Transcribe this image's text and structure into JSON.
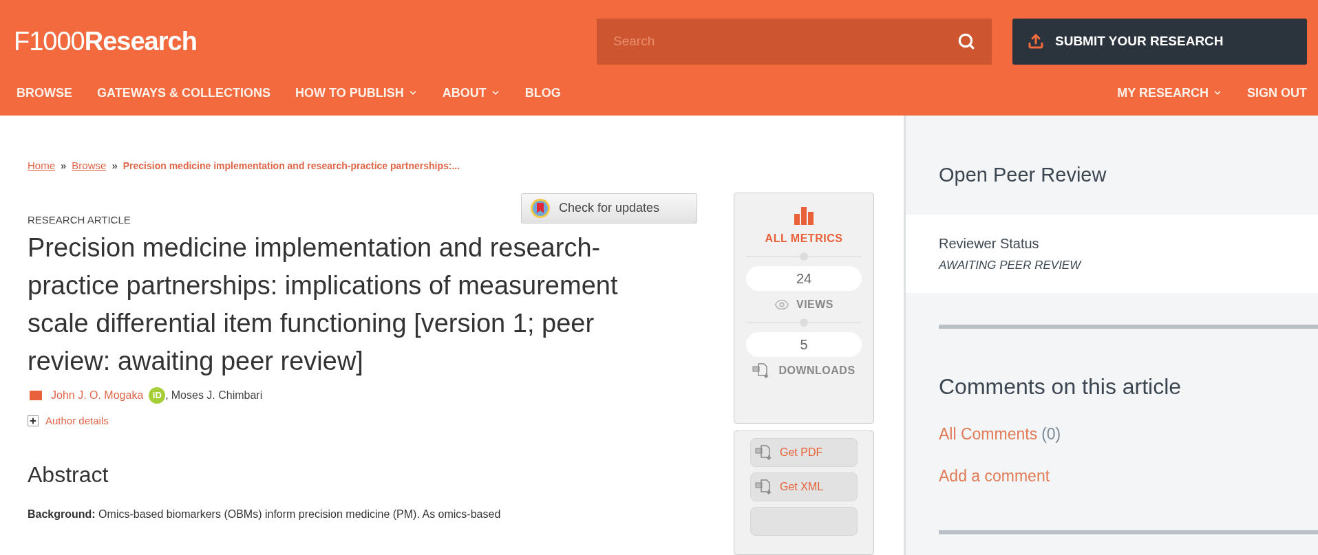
{
  "header": {
    "logo": "F1000**Research**",
    "search": {
      "placeholder": "Search"
    },
    "submit_button": "SUBMIT YOUR RESEARCH"
  },
  "nav": {
    "left": [
      {
        "label": "BROWSE",
        "dropdown": false
      },
      {
        "label": "GATEWAYS & COLLECTIONS",
        "dropdown": false
      },
      {
        "label": "HOW TO PUBLISH",
        "dropdown": true
      },
      {
        "label": "ABOUT",
        "dropdown": true
      },
      {
        "label": "BLOG",
        "dropdown": false
      }
    ],
    "right": [
      {
        "label": "MY RESEARCH",
        "dropdown": true
      },
      {
        "label": "SIGN OUT",
        "dropdown": false
      }
    ]
  },
  "breadcrumb": [
    {
      "label": "Home",
      "kind": "link"
    },
    {
      "label": "»",
      "kind": "separator"
    },
    {
      "label": "Browse",
      "kind": "link"
    },
    {
      "label": "»",
      "kind": "separator"
    },
    {
      "label": "Precision medicine implementation and research-practice partnerships:...",
      "kind": "current"
    }
  ],
  "check_updates_button": "Check for updates",
  "article": {
    "type_label": "RESEARCH ARTICLE",
    "title": "Precision medicine implementation and research-practice partnerships: implications of measurement scale differential item functioning [version 1; peer review: awaiting peer review]",
    "authors": [
      {
        "name": "John J. O. Mogaka",
        "corresponding": true,
        "orcid_label": "iD",
        "link": true
      },
      {
        "name": "Moses J. Chimbari",
        "corresponding": false,
        "link": false
      }
    ],
    "author_separator": ",",
    "author_details": "Author details",
    "abstract_heading": "Abstract",
    "abstract_text": "**Background:** Omics-based biomarkers (OBMs) inform precision medicine (PM). As omics-based"
  },
  "metrics": {
    "all_metrics": "ALL METRICS",
    "stats": [
      {
        "value": "24",
        "label": "VIEWS",
        "kind": "views"
      },
      {
        "value": "5",
        "label": "DOWNLOADS",
        "kind": "downloads"
      }
    ]
  },
  "downloads": [
    "Get PDF",
    "Get XML"
  ],
  "peer_review": {
    "heading": "Open Peer Review",
    "status_label": "Reviewer Status",
    "status_value": "AWAITING PEER REVIEW"
  },
  "comments": {
    "heading": "Comments on this article",
    "all_comments": "All Comments",
    "count": "(0)",
    "add_comment": "Add a comment"
  }
}
